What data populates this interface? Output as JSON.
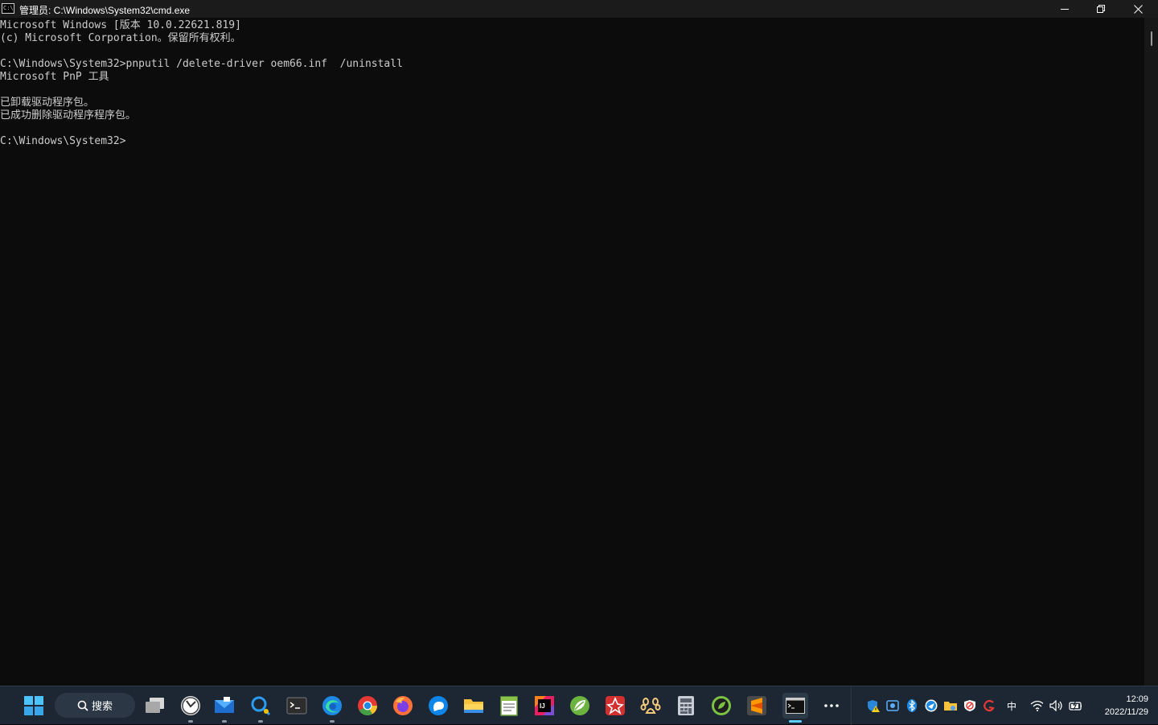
{
  "window": {
    "title": "管理员: C:\\Windows\\System32\\cmd.exe",
    "icon_text": "C:\\"
  },
  "console": {
    "lines": [
      "Microsoft Windows [版本 10.0.22621.819]",
      "(c) Microsoft Corporation。保留所有权利。",
      "",
      "C:\\Windows\\System32>pnputil /delete-driver oem66.inf  /uninstall",
      "Microsoft PnP 工具",
      "",
      "已卸载驱动程序包。",
      "已成功删除驱动程序程序包。",
      "",
      "C:\\Windows\\System32>"
    ]
  },
  "taskbar": {
    "search_label": "搜索",
    "apps": [
      {
        "name": "task-view",
        "icon": "task-view-icon"
      },
      {
        "name": "clock-app",
        "icon": "clock-icon"
      },
      {
        "name": "mail",
        "icon": "mail-icon"
      },
      {
        "name": "search-tool",
        "icon": "magnifier-app-icon"
      },
      {
        "name": "terminal",
        "icon": "terminal-icon"
      },
      {
        "name": "edge",
        "icon": "edge-browser-icon"
      },
      {
        "name": "chrome",
        "icon": "chrome-browser-icon"
      },
      {
        "name": "firefox",
        "icon": "firefox-browser-icon"
      },
      {
        "name": "chat",
        "icon": "chat-app-icon"
      },
      {
        "name": "file-explorer",
        "icon": "folder-icon"
      },
      {
        "name": "notepad-plus",
        "icon": "notepad-icon"
      },
      {
        "name": "intellij",
        "icon": "intellij-icon"
      },
      {
        "name": "green-app",
        "icon": "leaf-app-icon"
      },
      {
        "name": "red-app",
        "icon": "red-app-icon"
      },
      {
        "name": "baidu-netdisk",
        "icon": "paw-icon"
      },
      {
        "name": "calculator",
        "icon": "calculator-icon"
      },
      {
        "name": "green-circle-app",
        "icon": "green-circle-icon"
      },
      {
        "name": "sublime-text",
        "icon": "sublime-icon"
      },
      {
        "name": "cmd",
        "icon": "cmd-icon"
      }
    ],
    "tray": {
      "ime": "中",
      "time": "12:09",
      "date": "2022/11/29"
    }
  },
  "colors": {
    "console_bg": "#0c0c0c",
    "console_fg": "#cccccc",
    "titlebar_bg": "#1b1b1b",
    "taskbar_bg": "#1c2733",
    "accent": "#60cdff"
  }
}
